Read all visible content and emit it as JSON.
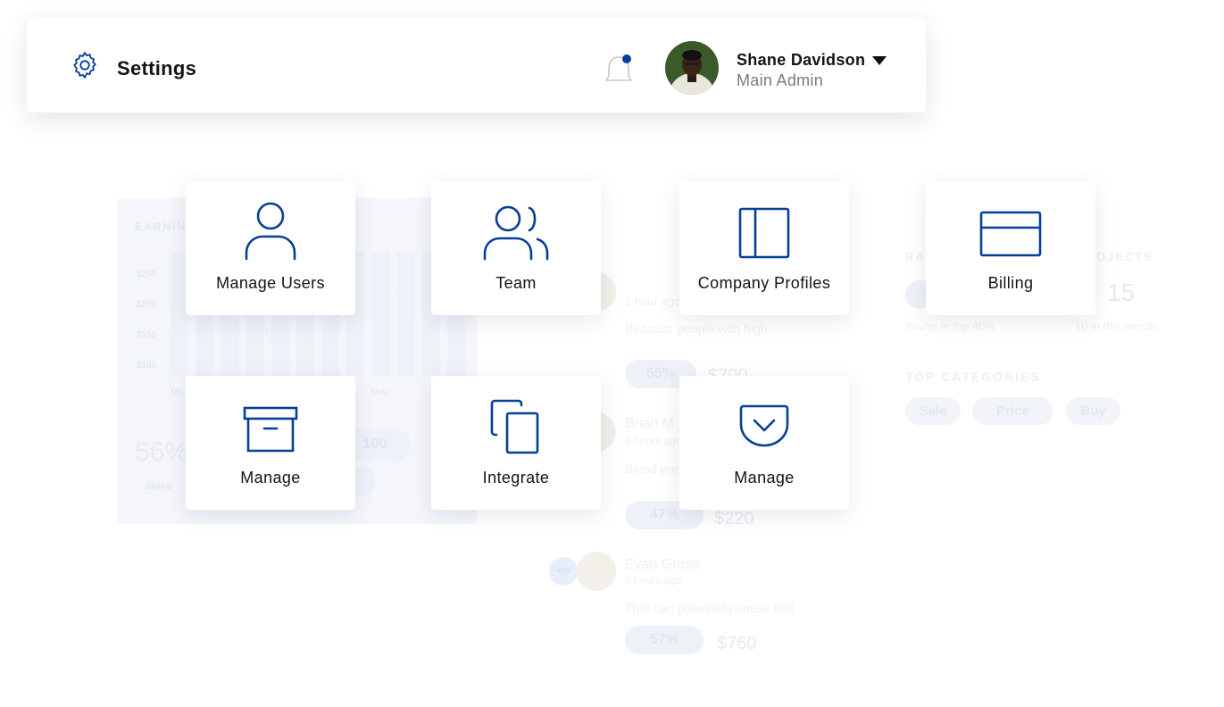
{
  "colors": {
    "accent": "#063F9A",
    "text": "#141414",
    "muted": "#7A7A7A",
    "notification_dot": "#063F9A"
  },
  "header": {
    "title": "Settings",
    "icon": "gear-icon",
    "notification_icon": "bell-icon",
    "user": {
      "name": "Shane Davidson",
      "role": "Main Admin",
      "menu_icon": "caret-down-icon"
    }
  },
  "tiles": [
    {
      "label": "Manage Users",
      "icon": "user-icon"
    },
    {
      "label": "Team",
      "icon": "users-icon"
    },
    {
      "label": "Company Profiles",
      "icon": "sidebar-layout-icon"
    },
    {
      "label": "Billing",
      "icon": "credit-card-icon"
    },
    {
      "label": "Manage",
      "icon": "archive-box-icon"
    },
    {
      "label": "Integrate",
      "icon": "copy-icon"
    },
    {
      "label": "Manage",
      "icon": "pocket-icon"
    }
  ],
  "background": {
    "earnings": {
      "title": "EARNINGS",
      "ticks": [
        "$250",
        "$200",
        "$150",
        "$100"
      ],
      "months": [
        "Mo",
        "",
        "",
        "",
        "Nov",
        "J"
      ],
      "big_value": "56%",
      "sub": "since",
      "pill_value": "100"
    },
    "activity": {
      "title": "TY",
      "items": [
        {
          "name": "",
          "time": "1 hour ago",
          "text": "Because people with high",
          "percent": "55%",
          "price": "$700"
        },
        {
          "name": "Brian M",
          "time": "3 hours ago",
          "text": "Blood pre",
          "percent": "47%",
          "price": "$220"
        },
        {
          "name": "Evan Gross",
          "time": "3 hours ago",
          "text": "That can potentially cause blot",
          "percent": "57%",
          "price": "$760",
          "icon_text": "</>"
        }
      ]
    },
    "rank": {
      "title": "RA",
      "sub": "You're in top 40%"
    },
    "projects": {
      "title": "OJECTS",
      "value": "15",
      "sub": "10 in this month"
    },
    "categories": {
      "title": "TOP CATEGORIES",
      "items": [
        "Sale",
        "Price",
        "Buy"
      ]
    }
  }
}
